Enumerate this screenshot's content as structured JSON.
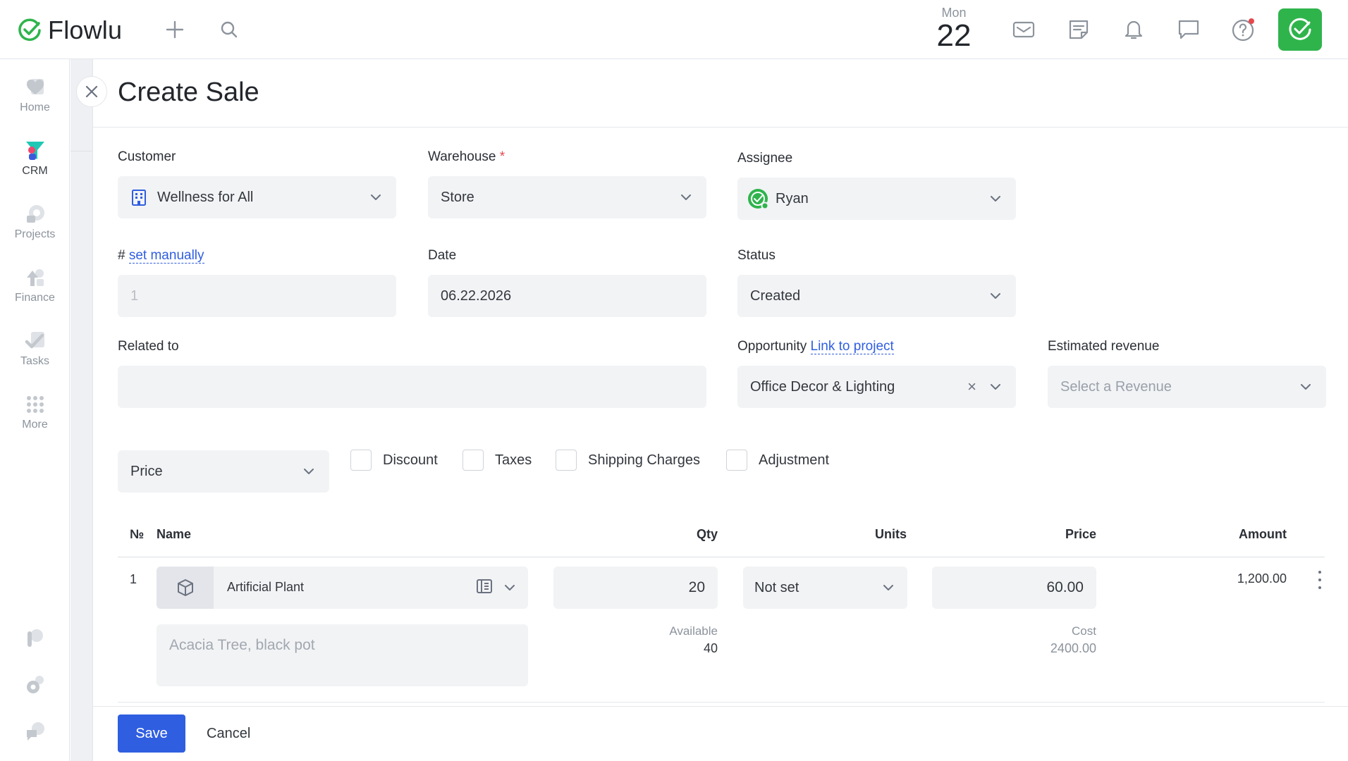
{
  "app": {
    "name": "Flowlu",
    "accent": "#2fb44c",
    "primary": "#2f5ee0"
  },
  "header": {
    "date_day": "Mon",
    "date_num": "22",
    "icons": [
      "plus-icon",
      "search-icon",
      "mail-icon",
      "notes-icon",
      "bell-icon",
      "chat-icon",
      "help-icon",
      "app-check-icon"
    ]
  },
  "sidebar": {
    "items": [
      {
        "label": "Home",
        "icon": "heart-icon"
      },
      {
        "label": "CRM",
        "icon": "funnel-icon"
      },
      {
        "label": "Projects",
        "icon": "projects-icon"
      },
      {
        "label": "Finance",
        "icon": "finance-icon"
      },
      {
        "label": "Tasks",
        "icon": "tasks-icon"
      },
      {
        "label": "More",
        "icon": "grid-dots-icon"
      }
    ]
  },
  "panel": {
    "title": "Create Sale",
    "customer": {
      "label": "Customer",
      "value": "Wellness for All"
    },
    "warehouse": {
      "label": "Warehouse",
      "required": "*",
      "value": "Store"
    },
    "assignee": {
      "label": "Assignee",
      "value": "Ryan"
    },
    "number": {
      "prefix": "#",
      "link": "set manually",
      "value": "1"
    },
    "date": {
      "label": "Date",
      "value": "06.22.2026"
    },
    "status": {
      "label": "Status",
      "value": "Created"
    },
    "related": {
      "label": "Related to",
      "value": ""
    },
    "opportunity": {
      "label": "Opportunity",
      "link": "Link to project",
      "value": "Office Decor & Lighting",
      "clear": "×"
    },
    "revenue": {
      "label": "Estimated revenue",
      "placeholder": "Select a Revenue"
    },
    "price_type": {
      "value": "Price"
    },
    "options": [
      "Discount",
      "Taxes",
      "Shipping Charges",
      "Adjustment"
    ]
  },
  "table": {
    "headers": {
      "num": "№",
      "name": "Name",
      "qty": "Qty",
      "units": "Units",
      "price": "Price",
      "amount": "Amount"
    },
    "rows": [
      {
        "num": "1",
        "name": "Artificial Plant",
        "description_placeholder": "Acacia Tree, black pot",
        "qty": "20",
        "available_label": "Available",
        "available": "40",
        "units": "Not set",
        "price": "60.00",
        "cost_label": "Cost",
        "cost": "2400.00",
        "amount": "1,200.00"
      }
    ]
  },
  "footer": {
    "save": "Save",
    "cancel": "Cancel"
  }
}
